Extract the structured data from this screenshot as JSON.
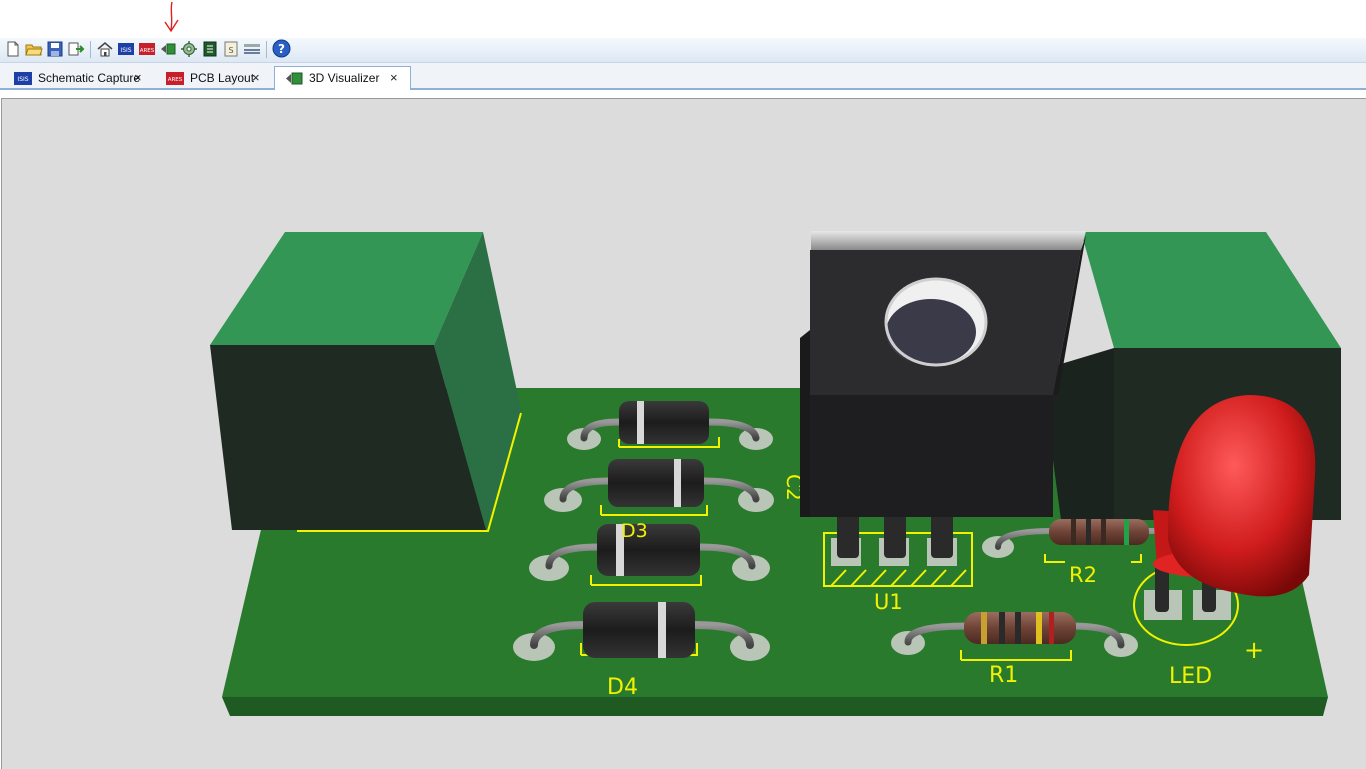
{
  "toolbar": {
    "buttons": [
      {
        "id": "new",
        "icon": "new-file-icon"
      },
      {
        "id": "open",
        "icon": "open-folder-icon"
      },
      {
        "id": "save",
        "icon": "save-icon"
      },
      {
        "id": "import",
        "icon": "import-icon"
      },
      {
        "id": "home",
        "icon": "home-icon"
      },
      {
        "id": "isis",
        "icon": "isis-icon",
        "text": "ISIS"
      },
      {
        "id": "ares",
        "icon": "ares-icon",
        "text": "ARES"
      },
      {
        "id": "3d",
        "icon": "3d-visualizer-icon"
      },
      {
        "id": "gerber",
        "icon": "gerber-viewer-icon"
      },
      {
        "id": "bom",
        "icon": "bill-of-materials-icon"
      },
      {
        "id": "source",
        "icon": "source-code-icon"
      },
      {
        "id": "design-explorer",
        "icon": "design-explorer-icon"
      },
      {
        "id": "help",
        "icon": "help-icon",
        "text": "?"
      }
    ],
    "isis_text": "ISIS",
    "ares_text": "ARES",
    "help_text": "?"
  },
  "tabs": [
    {
      "label": "Schematic Capture",
      "icon": "isis-icon",
      "icon_text": "ISIS",
      "active": false,
      "close": "×"
    },
    {
      "label": "PCB Layout",
      "icon": "ares-icon",
      "icon_text": "ARES",
      "active": false,
      "close": "×"
    },
    {
      "label": "3D Visualizer",
      "icon": "3d-visualizer-icon",
      "active": true,
      "close": "×"
    }
  ],
  "board": {
    "labels": {
      "c2": "C2",
      "d3": "D3",
      "d4": "D4",
      "u1": "U1",
      "r1": "R1",
      "r2": "R2",
      "led": "LED",
      "led_plus": "+"
    },
    "colors": {
      "board": "#2a7a2e",
      "silkscreen": "#f2f200",
      "connector": "#2f8f52",
      "regulator": "#2a2a2c",
      "led": "#d42020",
      "background": "#dcdcdc"
    }
  }
}
